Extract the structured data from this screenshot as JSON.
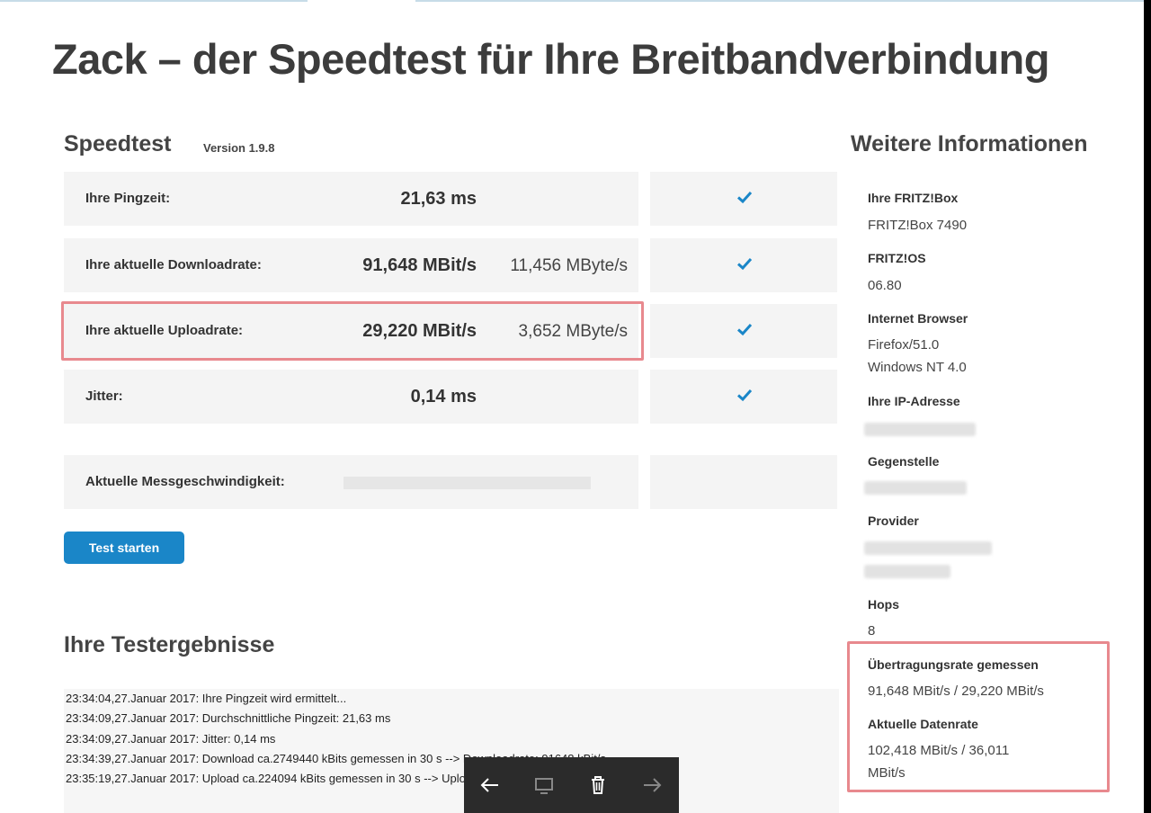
{
  "page": {
    "title": "Zack – der Speedtest für Ihre Breitbandverbindung"
  },
  "speedtest": {
    "heading": "Speedtest",
    "version": "Version 1.9.8",
    "rows": [
      {
        "label": "Ihre Pingzeit:",
        "value": "21,63 ms",
        "value2": ""
      },
      {
        "label": "Ihre aktuelle Downloadrate:",
        "value": "91,648 MBit/s",
        "value2": "11,456 MByte/s"
      },
      {
        "label": "Ihre aktuelle Uploadrate:",
        "value": "29,220 MBit/s",
        "value2": "3,652 MByte/s"
      },
      {
        "label": "Jitter:",
        "value": "0,14 ms",
        "value2": ""
      }
    ],
    "measurement_label": "Aktuelle Messgeschwindigkeit:",
    "measurement_progress": 0,
    "start_button": "Test starten",
    "check_icon": "checkmark-icon",
    "check_color": "#1a86c8"
  },
  "results": {
    "heading": "Ihre Testergebnisse",
    "log": [
      "23:34:04,27.Januar 2017: Ihre Pingzeit wird ermittelt...",
      "23:34:09,27.Januar 2017: Durchschnittliche Pingzeit: 21,63 ms",
      "23:34:09,27.Januar 2017: Jitter: 0,14 ms",
      "23:34:39,27.Januar 2017: Download ca.2749440 kBits gemessen in 30 s --> Downloadrate: 91648 kBit/s",
      "23:35:19,27.Januar 2017: Upload ca.224094 kBits gemessen in 30 s --> Uploadrate: 29220 kBit/s"
    ]
  },
  "info": {
    "heading": "Weitere Informationen",
    "fritzbox_label": "Ihre FRITZ!Box",
    "fritzbox_value": "FRITZ!Box 7490",
    "fritzos_label": "FRITZ!OS",
    "fritzos_value": "06.80",
    "browser_label": "Internet Browser",
    "browser_value1": "Firefox/51.0",
    "browser_value2": "Windows NT 4.0",
    "ip_label": "Ihre IP-Adresse",
    "remote_label": "Gegenstelle",
    "provider_label": "Provider",
    "hops_label": "Hops",
    "hops_value": "8",
    "rate_measured_label": "Übertragungsrate gemessen",
    "rate_measured_value": "91,648 MBit/s / 29,220 MBit/s",
    "current_rate_label": "Aktuelle Datenrate",
    "current_rate_value1": "102,418 MBit/s / 36,011",
    "current_rate_value2": "MBit/s"
  },
  "overlay": {
    "back_icon": "arrow-left-icon",
    "cast_icon": "cast-icon",
    "delete_icon": "trash-icon",
    "forward_icon": "arrow-right-icon"
  },
  "colors": {
    "highlight": "#e8898e",
    "accent": "#1a86c8",
    "row_bg": "#f4f4f4"
  }
}
